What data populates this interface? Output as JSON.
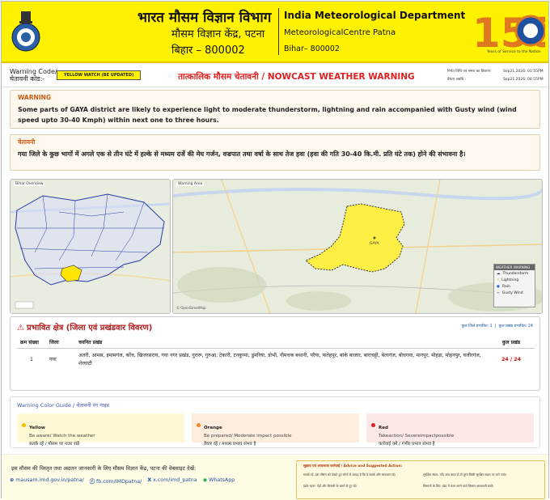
{
  "header": {
    "hindi_title": "भारत मौसम विज्ञान विभाग",
    "hindi_sub": "मौसम विज्ञान केंद्र, पटना",
    "hindi_addr": "बिहार – 800002",
    "en_title": "India Meteorological Department",
    "en_sub": "MeteorologicalCentre Patna",
    "en_addr": "Bihar– 800002",
    "logo_number": "150",
    "logo_caption": "Years of Service to the Nation"
  },
  "warning_bar": {
    "code_label_en": "Warning Code/",
    "code_label_hi": "चेतावनी कोड:-",
    "badge": "YELLOW WATCH (BE UPDATED)",
    "title": "तात्कालिक मौसम चेतावनी / NOWCAST WEATHER WARNING",
    "issued_label": "निर्गत तिथि एवं समय का विवरण:",
    "valid_label": "वैधता अवधि :",
    "issued_value": "Sep21,2026: 01:55PM",
    "valid_value": "Sep21,2026: 04:55PM"
  },
  "warning_en": {
    "title": "WARNING",
    "body": "Some parts of GAYA district are likely to experience light to moderate thunderstorm, lightning and rain accompanied with Gusty wind (wind speed upto 30-40 Kmph) within next one to three hours."
  },
  "warning_hi": {
    "title": "चेतावनी",
    "body": "गया जिले के कुछ भागों में अगले एक से तीन घंटे में हल्के से मध्यम दर्जे की मेघ गर्जन, वज्रपात तथा वर्षा के साथ तेज हवा (हवा की गति 30-40 कि.मी. प्रति घंटे तक) होने की संभावना है।"
  },
  "maps": {
    "overview_title": "Bihar Overview",
    "warning_title": "Warning Area",
    "city": "GAYA",
    "legend": {
      "title": "WEATHER WARNING",
      "items": [
        "Thunderstorm",
        "Lightning",
        "Rain",
        "Gusty Wind"
      ]
    },
    "attribution": "© OpenStreetMap"
  },
  "affected": {
    "title": "प्रभावित क्षेत्र (जिला एवं प्रखंडवार विवरण)",
    "districts_label": "कुल जिले प्रभावित: 1",
    "blocks_label": "कुल प्रखंड प्रभावित: 24",
    "headers": [
      "क्रम संख्या",
      "जिला",
      "चयनित प्रखंड",
      "कुल प्रखंड"
    ],
    "row": {
      "num": "1",
      "district": "गया",
      "blocks": "अतरी, आमस, इमामगंज, कोंच, खिजरसराय, गया नगर प्रखंड, गुरारू, गुरुआ, टेकारी, टनकुप्पा, डुमरिया, डोभी, नीमचक बथानी, परैया, फतेहपुर, बांके बाजार, बाराचट्टी, बेलागंज, बोधगया, मानपुर, मोहड़ा, मोहनपुर, वजीरगंज, शेरघाटी",
      "total": "24 / 24"
    }
  },
  "color_guide": {
    "title": "Warning Color Guide / चेतावनी रंग गाइड",
    "cards": [
      {
        "name": "Yellow",
        "en": "Be aware/ Watch the weather",
        "hi": "सतर्क रहें / मौसम पर नजर रखें",
        "color": "#f2c200"
      },
      {
        "name": "Orange",
        "en": "Be prepared/ Moderate impact possible",
        "hi": "तैयार रहें / मध्यम प्रभाव संभव है",
        "color": "#f08a20"
      },
      {
        "name": "Red",
        "en": "Takeaction/ Severeimpactpossible",
        "hi": "कार्रवाई करें / गंभीर प्रभाव संभव है",
        "color": "#e02020"
      }
    ]
  },
  "footer": {
    "text": "इस मौसम की विस्तृत तथा अद्यतन जानकारी के लिए मौसम विज्ञान केंद्र, पटना की वेबसाइट देखें:",
    "links": [
      "mausam.imd.gov.in/patna/",
      "fb.com/IMDpatna/",
      "x.com/imd_patna",
      "WhatsApp"
    ],
    "advice_title": "सुझाव एवं आवश्यक कार्रवाई / Advice and Suggested Action:",
    "advice": [
      "सतर्क रहें: इस मौसम को देखते हुए लोगों से आग्रह है कि वे सतर्क और सावधान रहें।",
      "सुरक्षित स्थान: यदि आप बाहर हैं तो तुरंत किसी सुरक्षित स्थान पर चले जाएं।",
      "इंडोर रहना: पेड़ों और बिजली के खंभों से दूर रहें।",
      "किसानों के लिए: खेत में काम करने वाले किसान सावधानी बरतें।"
    ]
  },
  "colors": {
    "header_yellow": "#fff200",
    "alert_red": "#e02020",
    "link_blue": "#1f4f9f"
  }
}
